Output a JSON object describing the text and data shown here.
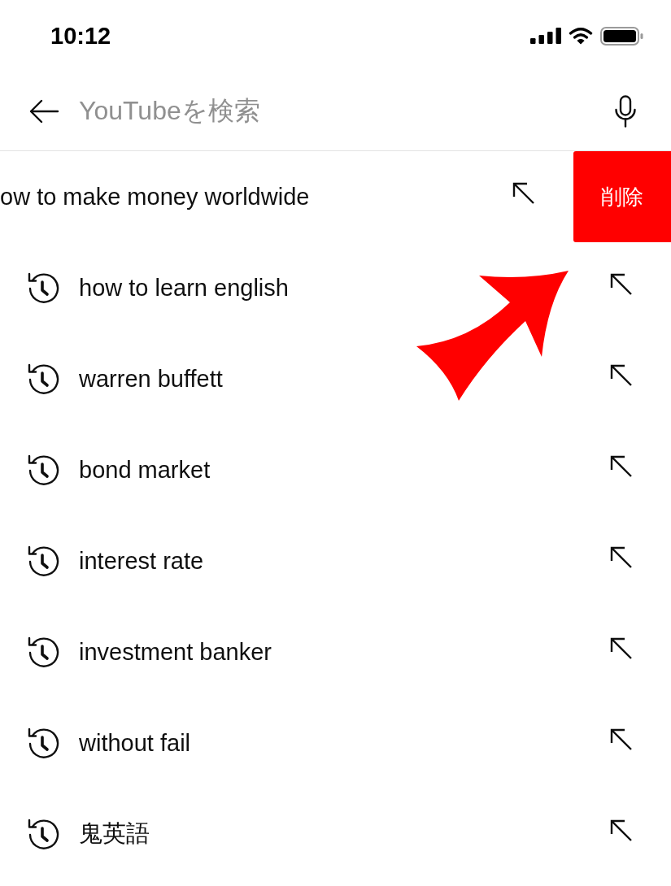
{
  "status_bar": {
    "time": "10:12"
  },
  "search_bar": {
    "placeholder": "YouTubeを検索"
  },
  "history": [
    {
      "text": "ow to make money worldwide",
      "swiped": true,
      "delete_label": "削除"
    },
    {
      "text": "how to learn english",
      "swiped": false
    },
    {
      "text": "warren buffett",
      "swiped": false
    },
    {
      "text": "bond market",
      "swiped": false
    },
    {
      "text": "interest rate",
      "swiped": false
    },
    {
      "text": "investment banker",
      "swiped": false
    },
    {
      "text": "without fail",
      "swiped": false
    },
    {
      "text": "鬼英語",
      "swiped": false
    }
  ]
}
